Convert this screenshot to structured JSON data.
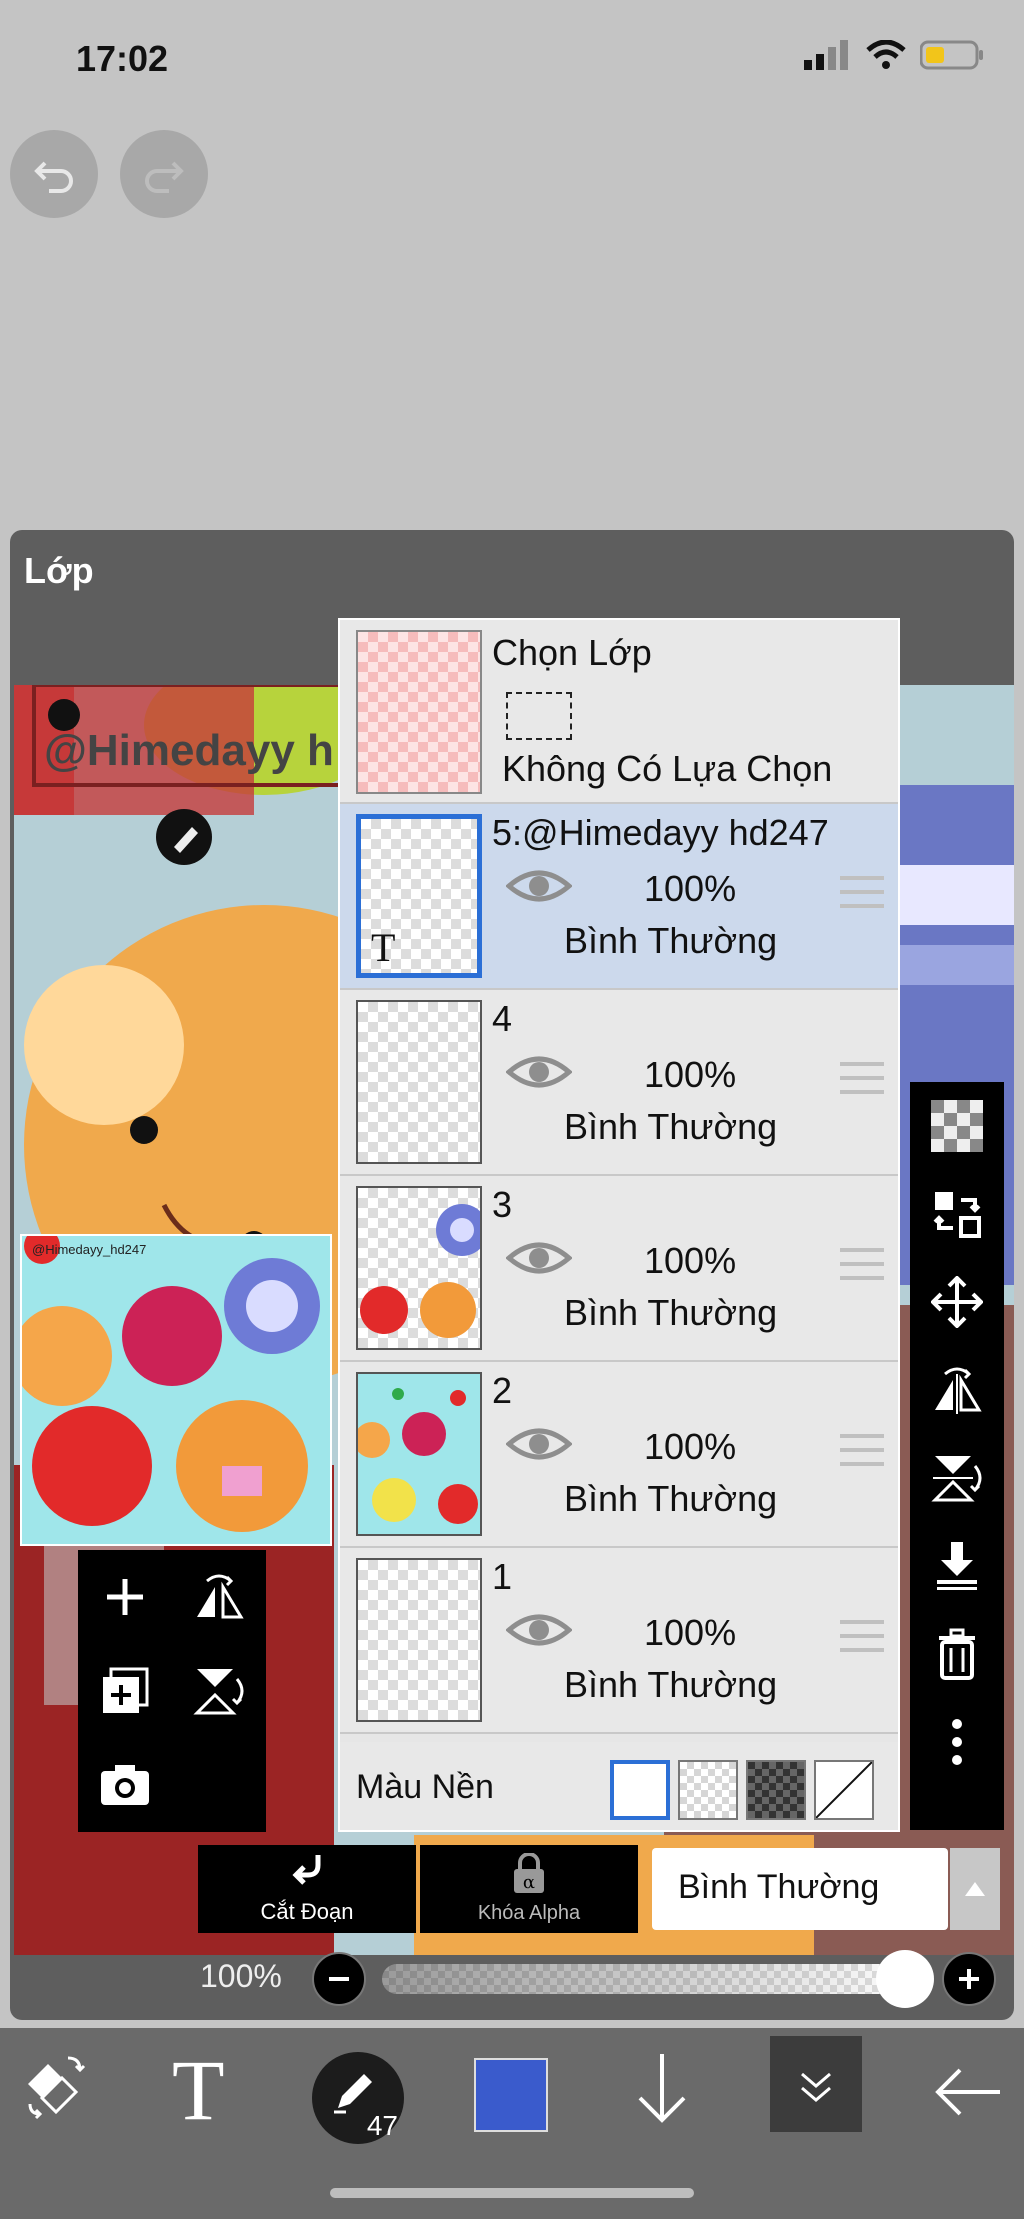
{
  "status": {
    "time": "17:02"
  },
  "panel": {
    "title": "Lớp"
  },
  "canvas": {
    "watermark_text": "@Himedayy h",
    "small_watermark": "@Himedayy_hd247"
  },
  "selection_layer": {
    "title": "Chọn Lớp",
    "status": "Không Có Lựa Chọn"
  },
  "layers": [
    {
      "name": "5:@Himedayy hd247",
      "opacity": "100%",
      "blend": "Bình Thường",
      "type_badge": "T",
      "active": true
    },
    {
      "name": "4",
      "opacity": "100%",
      "blend": "Bình Thường",
      "active": false
    },
    {
      "name": "3",
      "opacity": "100%",
      "blend": "Bình Thường",
      "active": false
    },
    {
      "name": "2",
      "opacity": "100%",
      "blend": "Bình Thường",
      "active": false
    },
    {
      "name": "1",
      "opacity": "100%",
      "blend": "Bình Thường",
      "active": false
    }
  ],
  "background": {
    "label": "Màu Nền"
  },
  "right_toolbar": [
    "checker-icon",
    "swap-layers-icon",
    "move-icon",
    "flip-horizontal-icon",
    "flip-vertical-icon",
    "merge-down-icon",
    "trash-icon",
    "more-vertical-icon"
  ],
  "left_toolbar": [
    "add-layer-icon",
    "flip-layer-horizontal-icon",
    "duplicate-layer-icon",
    "flip-layer-vertical-icon",
    "camera-icon"
  ],
  "bottom_controls": {
    "cut_label": "Cắt Đoạn",
    "alpha_label": "Khóa Alpha",
    "blend_mode": "Bình Thường",
    "opacity_label": "100%",
    "opacity_value": 1.0
  },
  "bottom_nav": {
    "brush_size": "47",
    "text_tool": "T"
  },
  "colors": {
    "accent": "#2b6fd6",
    "current_color": "#3a5bcc",
    "active_row": "#ccd9ec"
  }
}
